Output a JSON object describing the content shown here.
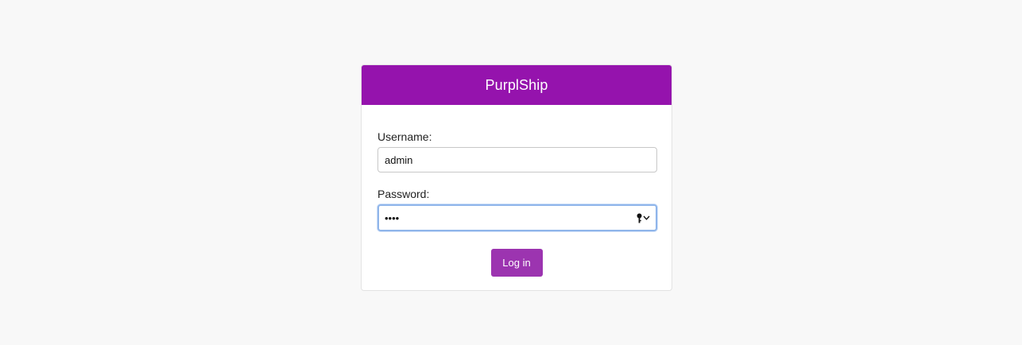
{
  "card": {
    "title": "PurplShip"
  },
  "form": {
    "username_label": "Username:",
    "username_value": "admin",
    "password_label": "Password:",
    "password_value": "1234",
    "submit_label": "Log in"
  },
  "icons": {
    "password_key": "key-icon",
    "password_dropdown": "chevron-down-icon"
  },
  "colors": {
    "header": "#9513ad",
    "button": "#9c34b0",
    "focus_border": "#8fb5ea",
    "background": "#f8f8f8"
  }
}
